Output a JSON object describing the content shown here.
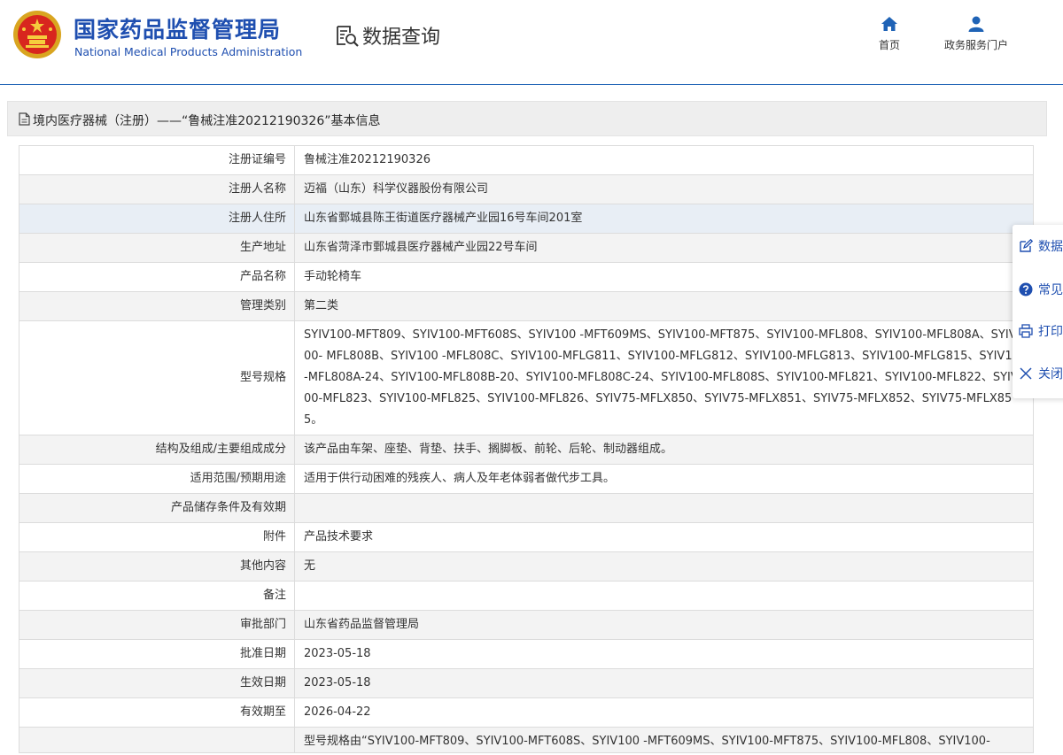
{
  "header": {
    "brand_cn": "国家药品监督管理局",
    "brand_en": "National Medical Products Administration",
    "query_title": "数据查询",
    "nav": {
      "home": "首页",
      "portal": "政务服务门户"
    }
  },
  "page": {
    "title": "境内医疗器械（注册）——“鲁械注准20212190326”基本信息"
  },
  "rows": [
    {
      "label": "注册证编号",
      "value": "鲁械注准20212190326"
    },
    {
      "label": "注册人名称",
      "value": "迈福（山东）科学仪器股份有限公司"
    },
    {
      "label": "注册人住所",
      "value": "山东省鄄城县陈王街道医疗器械产业园16号车间201室"
    },
    {
      "label": "生产地址",
      "value": "山东省菏泽市鄄城县医疗器械产业园22号车间"
    },
    {
      "label": "产品名称",
      "value": "手动轮椅车"
    },
    {
      "label": "管理类别",
      "value": "第二类"
    },
    {
      "label": "型号规格",
      "value": "SYIV100-MFT809、SYIV100-MFT608S、SYIV100 -MFT609MS、SYIV100-MFT875、SYIV100-MFL808、SYIV100-MFL808A、SYIV100- MFL808B、SYIV100 -MFL808C、SYIV100-MFLG811、SYIV100-MFLG812、SYIV100-MFLG813、SYIV100-MFLG815、SYIV100-MFL808A-24、SYIV100-MFL808B-20、SYIV100-MFL808C-24、SYIV100-MFL808S、SYIV100-MFL821、SYIV100-MFL822、SYIV100-MFL823、SYIV100-MFL825、SYIV100-MFL826、SYIV75-MFLX850、SYIV75-MFLX851、SYIV75-MFLX852、SYIV75-MFLX855。"
    },
    {
      "label": "结构及组成/主要组成成分",
      "value": "该产品由车架、座垫、背垫、扶手、搁脚板、前轮、后轮、制动器组成。"
    },
    {
      "label": "适用范围/预期用途",
      "value": "适用于供行动困难的残疾人、病人及年老体弱者做代步工具。"
    },
    {
      "label": "产品储存条件及有效期",
      "value": ""
    },
    {
      "label": "附件",
      "value": "产品技术要求"
    },
    {
      "label": "其他内容",
      "value": "无"
    },
    {
      "label": "备注",
      "value": ""
    },
    {
      "label": "审批部门",
      "value": "山东省药品监督管理局"
    },
    {
      "label": "批准日期",
      "value": "2023-05-18"
    },
    {
      "label": "生效日期",
      "value": "2023-05-18"
    },
    {
      "label": "有效期至",
      "value": "2026-04-22"
    },
    {
      "label": "",
      "value": "型号规格由“SYIV100-MFT809、SYIV100-MFT608S、SYIV100 -MFT609MS、SYIV100-MFT875、SYIV100-MFL808、SYIV100-"
    }
  ],
  "side_tools": {
    "data_label": "数据",
    "faq_label": "常见",
    "print_label": "打印",
    "close_label": "关闭"
  },
  "colors": {
    "brand_blue": "#1f4fb0",
    "home_icon_blue": "#1f63b6"
  }
}
